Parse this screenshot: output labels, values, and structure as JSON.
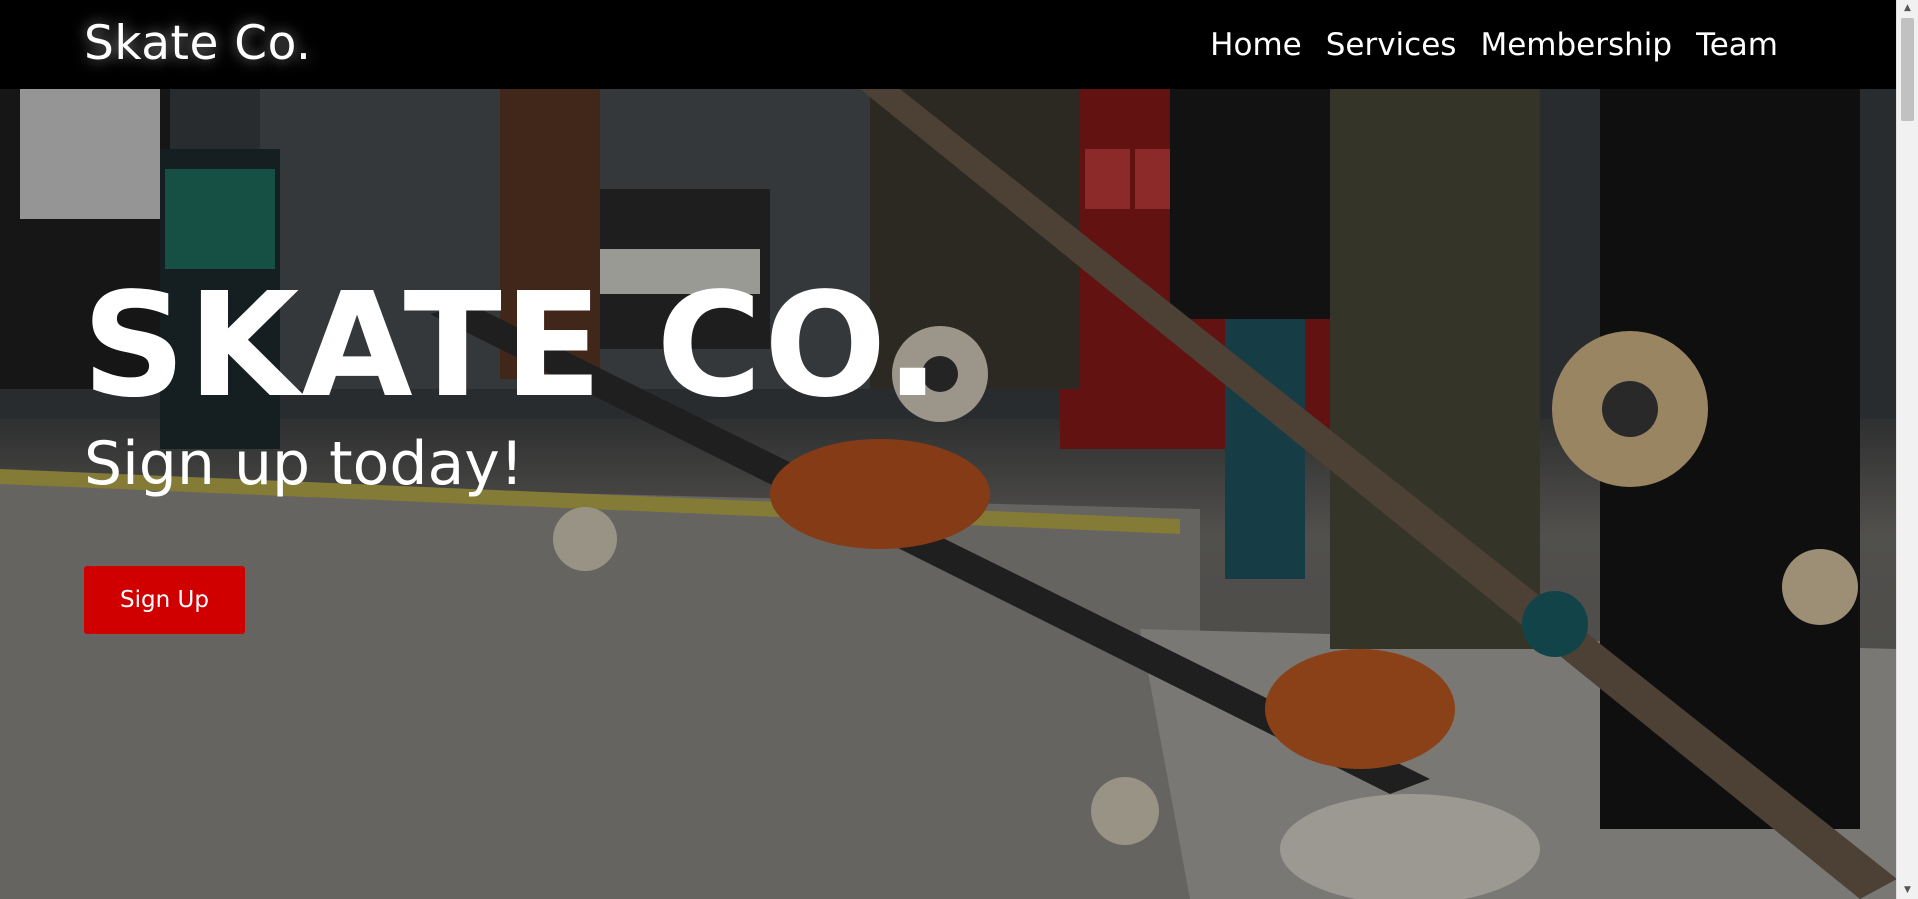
{
  "navbar": {
    "brand": "Skate Co.",
    "links": [
      {
        "label": "Home"
      },
      {
        "label": "Services"
      },
      {
        "label": "Membership"
      },
      {
        "label": "Team"
      }
    ]
  },
  "hero": {
    "title": "SKATE CO.",
    "subtitle": "Sign up today!",
    "cta_label": "Sign Up",
    "cta_color": "#d10000"
  },
  "scrollbar": {
    "up_icon": "triangle-up-icon",
    "down_icon": "triangle-down-icon"
  }
}
